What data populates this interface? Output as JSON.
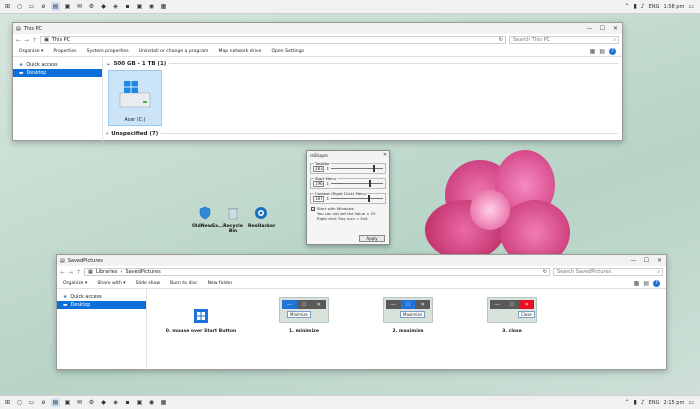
{
  "colors": {
    "accent": "#0a6fd8",
    "desktop": "#c9ded3",
    "flower": "#e0458a"
  },
  "taskbar": {
    "top": {
      "lang": "ENG",
      "time": "1:58 pm",
      "icons": [
        "start-icon",
        "search-icon",
        "task-view-icon",
        "edge-icon",
        "file-explorer-icon",
        "store-icon",
        "mail-icon",
        "settings-icon",
        "app-icon"
      ]
    },
    "bottom": {
      "lang": "ENG",
      "time": "2:15 pm"
    }
  },
  "explorer1": {
    "title": "This PC",
    "address": "This PC",
    "search_placeholder": "Search This PC",
    "toolbar": [
      "Organize ▾",
      "Properties",
      "System properties",
      "Uninstall or change a program",
      "Map network drive",
      "Open Settings"
    ],
    "nav": [
      {
        "label": "Quick access"
      },
      {
        "label": "Desktop"
      }
    ],
    "group1": "500 GB - 1 TB (1)",
    "drive_label": "Acer (C:)",
    "group2": "Unspecified (7)"
  },
  "desktop_icons": [
    {
      "label": "OldNewEx..."
    },
    {
      "label": "Recycle Bin"
    },
    {
      "label": "ResHacker"
    }
  ],
  "tool": {
    "title": "reShaper",
    "fields": [
      {
        "legend": "TaskBar",
        "value": "283"
      },
      {
        "legend": "Start Menu",
        "value": "196"
      },
      {
        "legend": "Context (Right Click) Menu",
        "value": "187"
      }
    ],
    "checkbox_label": "Start with Windows",
    "note1": "You can not set the Value < 25",
    "note2": "Right click Tray icon = Exit",
    "apply": "Apply"
  },
  "explorer2": {
    "title": "SavedPictures",
    "address_root": "Libraries",
    "address_leaf": "SavedPictures",
    "search_placeholder": "Search SavedPictures",
    "toolbar": [
      "Organize ▾",
      "Share with ▾",
      "Slide show",
      "Burn to disc",
      "New folder"
    ],
    "nav": [
      {
        "label": "Quick access"
      },
      {
        "label": "Desktop"
      }
    ],
    "pictures": [
      {
        "label": "0. mouse over Start Button"
      },
      {
        "label": "1. minimize",
        "tip": "Minimize"
      },
      {
        "label": "2. maximize",
        "tip": "Maximize"
      },
      {
        "label": "3. close",
        "tip": "Close"
      }
    ]
  }
}
